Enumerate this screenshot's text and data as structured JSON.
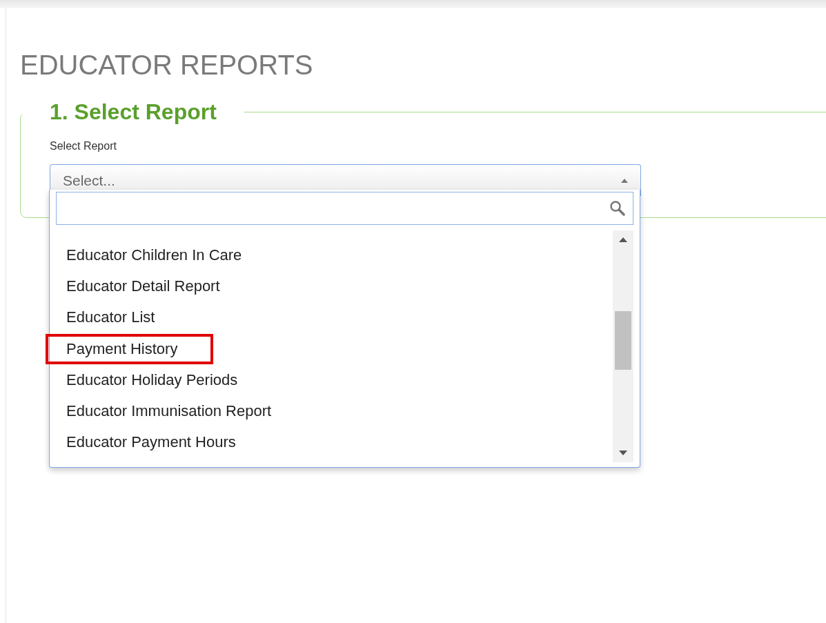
{
  "page": {
    "title": "EDUCATOR REPORTS"
  },
  "section": {
    "legend": "1. Select Report",
    "field_label": "Select Report",
    "select": {
      "value": "Select...",
      "expanded": true
    },
    "dropdown": {
      "items": [
        {
          "label": "Educator Children In Care",
          "highlighted": false
        },
        {
          "label": "Educator Detail Report",
          "highlighted": false
        },
        {
          "label": "Educator List",
          "highlighted": false
        },
        {
          "label": "Payment History",
          "highlighted": true
        },
        {
          "label": "Educator Holiday Periods",
          "highlighted": false
        },
        {
          "label": "Educator Immunisation Report",
          "highlighted": false
        },
        {
          "label": "Educator Payment Hours",
          "highlighted": false
        }
      ]
    }
  }
}
